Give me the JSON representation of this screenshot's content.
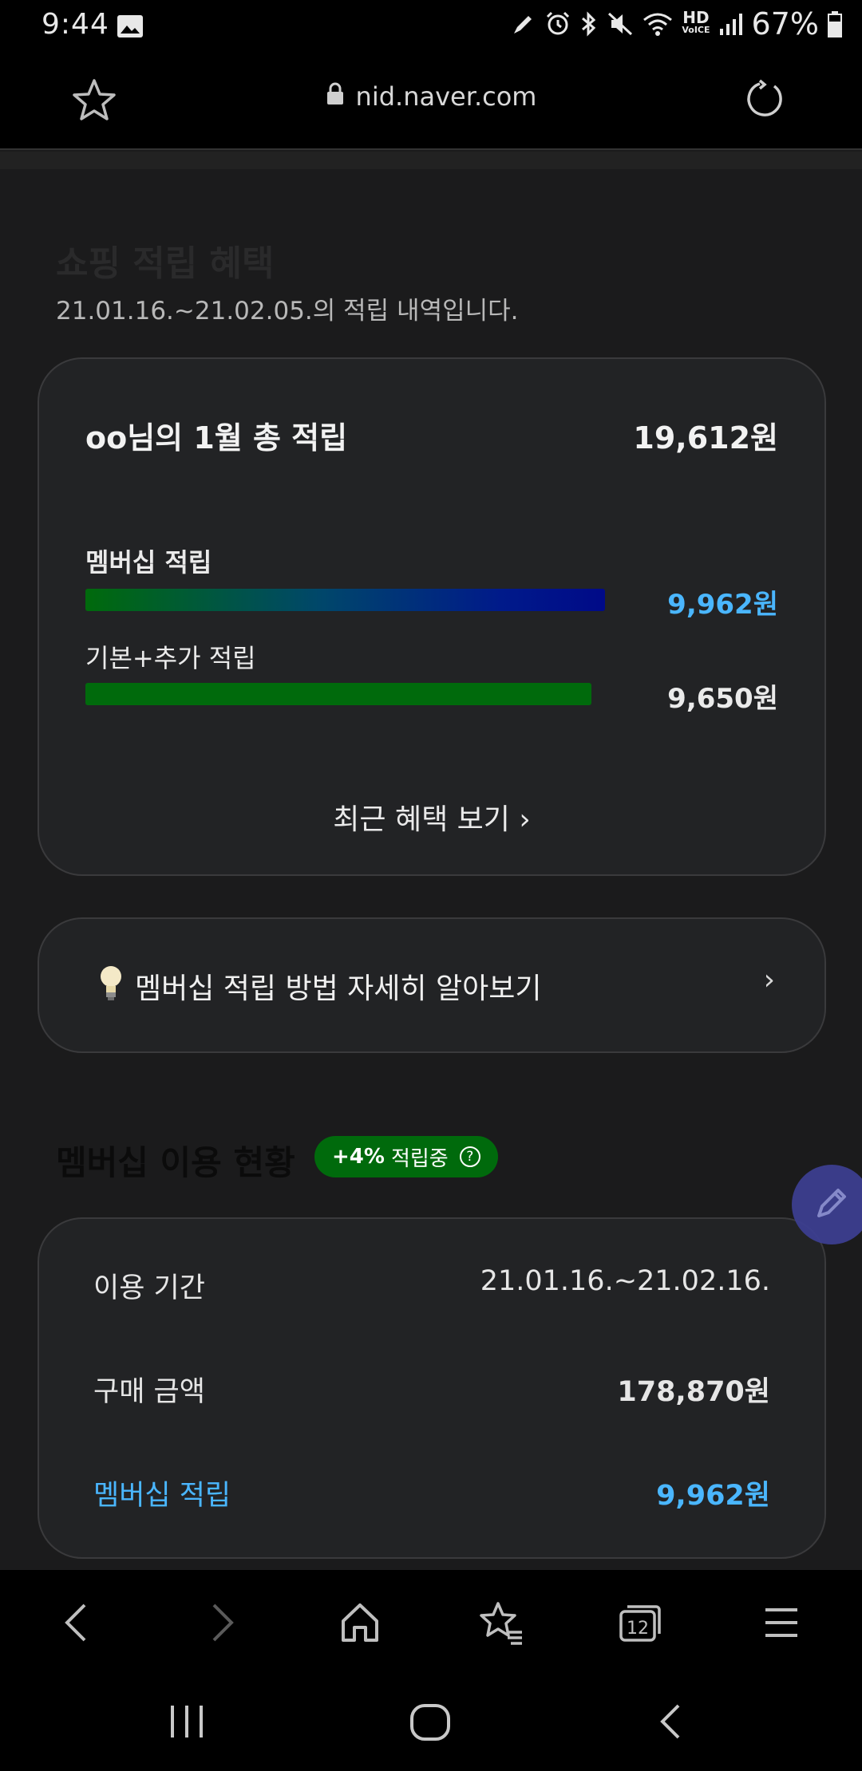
{
  "status_bar": {
    "time": "9:44",
    "hd_top": "HD",
    "hd_bottom": "VoICE",
    "battery": "67%"
  },
  "url_bar": {
    "url": "nid.naver.com"
  },
  "page": {
    "section_title": "쇼핑 적립 혜택",
    "period_text": "21.01.16.~21.02.05.의 적립 내역입니다.",
    "summary": {
      "total_label": "oo님의 1월 총 적립",
      "total_value": "19,612원",
      "membership_label": "멤버십 적립",
      "membership_value": "9,962원",
      "membership_fill": 0.75,
      "basic_label": "기본+추가 적립",
      "basic_value": "9,650원",
      "basic_fill": 0.73,
      "recent_link": "최근 혜택 보기 ›"
    },
    "guide_link": "멤버십 적립 방법 자세히 알아보기",
    "guide_chevron": "›",
    "usage": {
      "title": "멤버십 이용 현황",
      "badge_rate": "+4%",
      "badge_text": "적립중",
      "badge_help": "?",
      "period_label": "이용 기간",
      "period_value": "21.01.16.~21.02.16.",
      "purchase_label": "구매 금액",
      "purchase_value": "178,870원",
      "membership_label": "멤버십 적립",
      "membership_value": "9,962원"
    }
  },
  "browser_toolbar": {
    "tabs_count": "12"
  },
  "colors": {
    "accent_blue": "#4ab6ff",
    "badge_green": "#006a0c",
    "fab_purple": "#3d3f93"
  },
  "icons": [
    "image-icon",
    "pencil-icon",
    "alarm-icon",
    "bluetooth-icon",
    "mute-icon",
    "wifi-icon",
    "signal-icon",
    "battery-icon",
    "star-icon",
    "lock-icon",
    "reload-icon",
    "bulb-icon",
    "help-icon",
    "edit-icon",
    "back-icon",
    "forward-icon",
    "home-icon",
    "bookmarks-icon",
    "tabs-icon",
    "menu-icon",
    "recents-icon",
    "home-circle-icon",
    "system-back-icon"
  ]
}
